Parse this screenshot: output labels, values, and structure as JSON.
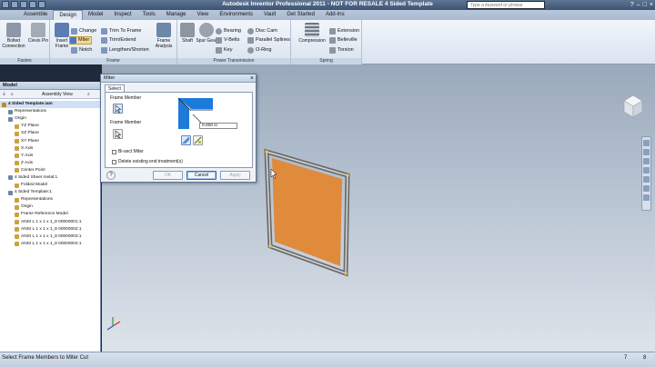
{
  "window": {
    "title": "Autodesk Inventor Professional 2011 - NOT FOR RESALE   4 Sided Template",
    "search_placeholder": "Type a keyword or phrase"
  },
  "tabs": [
    "Assemble",
    "Design",
    "Model",
    "Inspect",
    "Tools",
    "Manage",
    "View",
    "Environments",
    "Vault",
    "Get Started",
    "Add-Ins"
  ],
  "ribbon": {
    "fasten": {
      "label": "Fasten",
      "bolted": "Bolted Connection",
      "clevis": "Clevis Pin"
    },
    "frame": {
      "label": "Frame",
      "insert": "Insert Frame",
      "change": "Change",
      "miter": "Miter",
      "notch": "Notch",
      "trim_to_frame": "Trim To Frame",
      "trim_extend": "Trim/Extend",
      "lengthen": "Lengthen/Shorten",
      "analysis": "Frame Analysis"
    },
    "power": {
      "label": "Power Transmission",
      "shaft": "Shaft",
      "spur": "Spur Gear",
      "bearing": "Bearing",
      "vbelts": "V-Belts",
      "key": "Key",
      "disc_cam": "Disc Cam",
      "parallel_splines": "Parallel Splines",
      "oring": "O-Ring"
    },
    "spring": {
      "label": "Spring",
      "compression": "Compression",
      "extension": "Extension",
      "belleville": "Belleville",
      "torsion": "Torsion"
    }
  },
  "browser": {
    "title": "Model",
    "view_label": "Assembly View",
    "tree": [
      {
        "text": "4 Sided Template.iam",
        "indent": 0,
        "bold": true
      },
      {
        "text": "Representations",
        "indent": 1
      },
      {
        "text": "Origin",
        "indent": 1
      },
      {
        "text": "YZ Plane",
        "indent": 2
      },
      {
        "text": "XZ Plane",
        "indent": 2
      },
      {
        "text": "XY Plane",
        "indent": 2
      },
      {
        "text": "X Axis",
        "indent": 2
      },
      {
        "text": "Y Axis",
        "indent": 2
      },
      {
        "text": "Z Axis",
        "indent": 2
      },
      {
        "text": "Center Point",
        "indent": 2
      },
      {
        "text": "4 Sided Sheet metal:1",
        "indent": 1
      },
      {
        "text": "Folded Model",
        "indent": 2
      },
      {
        "text": "4 Sided Template:1",
        "indent": 1
      },
      {
        "text": "Representations",
        "indent": 2
      },
      {
        "text": "Origin",
        "indent": 2
      },
      {
        "text": "Frame Reference Model",
        "indent": 2
      },
      {
        "text": "ANSI L 1 x 1 x 1_8 00000001:1",
        "indent": 2
      },
      {
        "text": "ANSI L 1 x 1 x 1_8 00000002:1",
        "indent": 2
      },
      {
        "text": "ANSI L 1 x 1 x 1_8 00000003:1",
        "indent": 2
      },
      {
        "text": "ANSI L 1 x 1 x 1_8 00000004:1",
        "indent": 2
      }
    ]
  },
  "dialog": {
    "title": "Miter",
    "tab": "Select",
    "frame_member_1": "Frame Member",
    "frame_member_2": "Frame Member",
    "offset_value": "0.000 in",
    "bisect_miter": "Bi-sect Miter",
    "delete_existing": "Delete existing end treatment(s)",
    "ok": "OK",
    "cancel": "Cancel",
    "apply": "Apply"
  },
  "status": {
    "message": "Select Frame Members to Miter Cut",
    "count1": "7",
    "count2": "8"
  },
  "colors": {
    "panel": "#e08a3c",
    "frame_edge": "#6b6b6b",
    "ribbon_bg": "#e3ebf5",
    "accent": "#3d6aa8"
  }
}
